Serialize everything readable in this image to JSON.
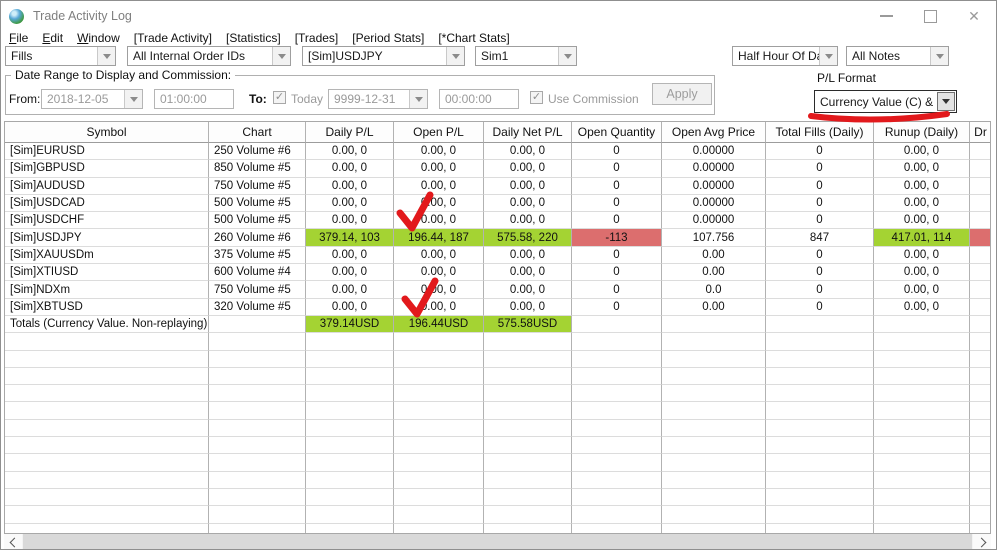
{
  "window": {
    "title": "Trade Activity Log"
  },
  "menu": {
    "items": [
      {
        "label": "File",
        "accel": true
      },
      {
        "label": "Edit",
        "accel": true
      },
      {
        "label": "Window",
        "accel": true
      },
      {
        "label": "[Trade Activity]",
        "accel": false
      },
      {
        "label": "[Statistics]",
        "accel": false
      },
      {
        "label": "[Trades]",
        "accel": false
      },
      {
        "label": "[Period Stats]",
        "accel": false
      },
      {
        "label": "[*Chart Stats]",
        "accel": false
      }
    ]
  },
  "toolbar": {
    "fills": "Fills",
    "order_ids": "All Internal Order IDs",
    "symbol": "[Sim]USDJPY",
    "account": "Sim1",
    "period": "Half Hour Of Day",
    "notes": "All Notes"
  },
  "date_range": {
    "group_label": "Date Range to Display and Commission:",
    "from_label": "From:",
    "from_date": "2018-12-05",
    "from_time": "01:00:00",
    "to_label": "To:",
    "today_label": "Today",
    "to_date": "9999-12-31",
    "to_time": "00:00:00",
    "use_commission_label": "Use Commission",
    "apply_label": "Apply"
  },
  "pl_format": {
    "label": "P/L Format",
    "value": "Currency Value (C) & T"
  },
  "table": {
    "columns": [
      "Symbol",
      "Chart",
      "Daily P/L",
      "Open P/L",
      "Daily Net P/L",
      "Open Quantity",
      "Open Avg Price",
      "Total Fills (Daily)",
      "Runup (Daily)",
      "Dr"
    ],
    "rows": [
      {
        "cells": [
          "[Sim]EURUSD",
          "250 Volume  #6",
          "0.00, 0",
          "0.00, 0",
          "0.00, 0",
          "0",
          "0.00000",
          "0",
          "0.00, 0",
          ""
        ],
        "hl": {}
      },
      {
        "cells": [
          "[Sim]GBPUSD",
          "850 Volume  #5",
          "0.00, 0",
          "0.00, 0",
          "0.00, 0",
          "0",
          "0.00000",
          "0",
          "0.00, 0",
          ""
        ],
        "hl": {}
      },
      {
        "cells": [
          "[Sim]AUDUSD",
          "750 Volume  #5",
          "0.00, 0",
          "0.00, 0",
          "0.00, 0",
          "0",
          "0.00000",
          "0",
          "0.00, 0",
          ""
        ],
        "hl": {}
      },
      {
        "cells": [
          "[Sim]USDCAD",
          "500 Volume  #5",
          "0.00, 0",
          "0.00, 0",
          "0.00, 0",
          "0",
          "0.00000",
          "0",
          "0.00, 0",
          ""
        ],
        "hl": {}
      },
      {
        "cells": [
          "[Sim]USDCHF",
          "500 Volume  #5",
          "0.00, 0",
          "0.00, 0",
          "0.00, 0",
          "0",
          "0.00000",
          "0",
          "0.00, 0",
          ""
        ],
        "hl": {}
      },
      {
        "cells": [
          "[Sim]USDJPY",
          "260 Volume  #6",
          "379.14, 103",
          "196.44, 187",
          "575.58, 220",
          "-113",
          "107.756",
          "847",
          "417.01, 114",
          ""
        ],
        "hl": {
          "2": "green",
          "3": "green",
          "4": "green",
          "5": "red",
          "8": "green",
          "9": "red"
        }
      },
      {
        "cells": [
          "[Sim]XAUUSDm",
          "375 Volume  #5",
          "0.00, 0",
          "0.00, 0",
          "0.00, 0",
          "0",
          "0.00",
          "0",
          "0.00, 0",
          ""
        ],
        "hl": {}
      },
      {
        "cells": [
          "[Sim]XTIUSD",
          "600 Volume  #4",
          "0.00, 0",
          "0.00, 0",
          "0.00, 0",
          "0",
          "0.00",
          "0",
          "0.00, 0",
          ""
        ],
        "hl": {}
      },
      {
        "cells": [
          "[Sim]NDXm",
          "750 Volume  #5",
          "0.00, 0",
          "0.00, 0",
          "0.00, 0",
          "0",
          "0.0",
          "0",
          "0.00, 0",
          ""
        ],
        "hl": {}
      },
      {
        "cells": [
          "[Sim]XBTUSD",
          "320 Volume  #5",
          "0.00, 0",
          "0.00, 0",
          "0.00, 0",
          "0",
          "0.00",
          "0",
          "0.00, 0",
          ""
        ],
        "hl": {}
      },
      {
        "cells": [
          "Totals (Currency Value. Non-replaying)",
          "",
          "379.14USD",
          "196.44USD",
          "575.58USD",
          "",
          "",
          "",
          "",
          ""
        ],
        "hl": {
          "2": "green",
          "3": "green",
          "4": "green"
        }
      }
    ]
  },
  "colors": {
    "green": "#a4d333",
    "red": "#dc6e6e",
    "annotation": "#e2191c"
  }
}
